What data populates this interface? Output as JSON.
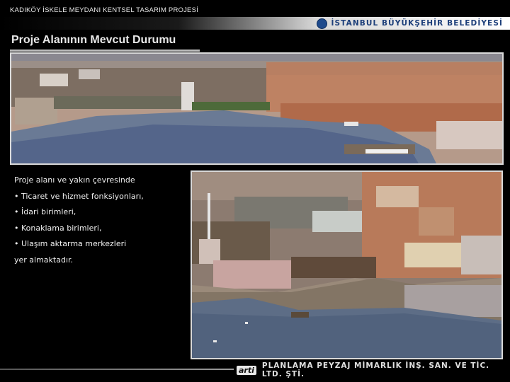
{
  "header": {
    "project_title": "KADIKÖY İSKELE MEYDANI KENTSEL TASARIM PROJESİ",
    "municipality": "İSTANBUL BÜYÜKŞEHİR BELEDİYESİ"
  },
  "slide": {
    "title": "Proje Alanının Mevcut Durumu",
    "body": {
      "intro": "Proje alanı ve yakın çevresinde",
      "items": [
        "• Ticaret ve hizmet fonksiyonları,",
        "• İdari birimleri,",
        "• Konaklama birimleri,",
        "• Ulaşım aktarma merkezleri"
      ],
      "outro": "yer almaktadır."
    }
  },
  "footer": {
    "logo_text": "arti",
    "company": "PLANLAMA PEYZAJ MİMARLIK İNŞ. SAN. VE TİC. LTD. ŞTİ."
  },
  "colors": {
    "background": "#000000",
    "municipality_blue": "#1d3f7a"
  }
}
